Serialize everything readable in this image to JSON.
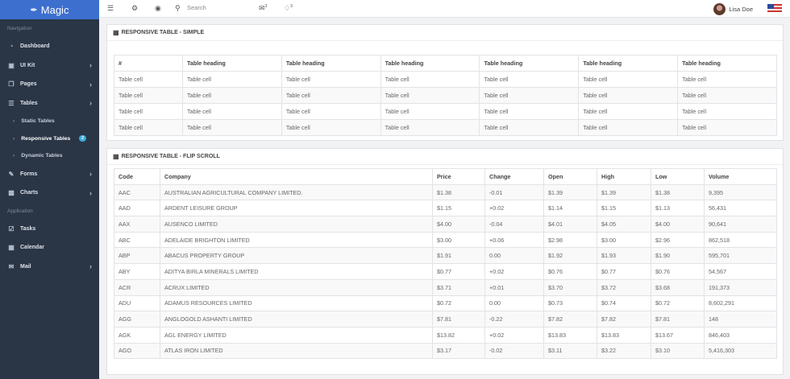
{
  "brand": {
    "name": "Magic",
    "icon": "feather-icon"
  },
  "sidebar": {
    "navigation_label": "Navigation",
    "application_label": "Application",
    "nav_items": [
      {
        "label": "Dashboard",
        "icon": "dashboard-icon"
      },
      {
        "label": "UI Kit",
        "icon": "box-icon"
      },
      {
        "label": "Pages",
        "icon": "pages-icon"
      },
      {
        "label": "Tables",
        "icon": "table-icon"
      }
    ],
    "sub_items": [
      {
        "label": "Static Tables"
      },
      {
        "label": "Responsive Tables",
        "badge": "2"
      },
      {
        "label": "Dynamic Tables"
      }
    ],
    "nav_items2": [
      {
        "label": "Forms",
        "icon": "pencil-icon"
      },
      {
        "label": "Charts",
        "icon": "chart-icon"
      }
    ],
    "app_items": [
      {
        "label": "Tasks",
        "icon": "tasks-icon"
      },
      {
        "label": "Calendar",
        "icon": "calendar-icon"
      },
      {
        "label": "Mail",
        "icon": "mail-icon"
      }
    ]
  },
  "topbar": {
    "search_placeholder": "Search",
    "mail_count": "3",
    "notif_count": "3",
    "user_name": "Lisa Doe"
  },
  "simple_table": {
    "title": "RESPONSIVE TABLE - SIMPLE",
    "headers": [
      "#",
      "Table heading",
      "Table heading",
      "Table heading",
      "Table heading",
      "Table heading",
      "Table heading"
    ],
    "rows": [
      [
        "Table cell",
        "Table cell",
        "Table cell",
        "Table cell",
        "Table cell",
        "Table cell",
        "Table cell"
      ],
      [
        "Table cell",
        "Table cell",
        "Table cell",
        "Table cell",
        "Table cell",
        "Table cell",
        "Table cell"
      ],
      [
        "Table cell",
        "Table cell",
        "Table cell",
        "Table cell",
        "Table cell",
        "Table cell",
        "Table cell"
      ],
      [
        "Table cell",
        "Table cell",
        "Table cell",
        "Table cell",
        "Table cell",
        "Table cell",
        "Table cell"
      ]
    ]
  },
  "flip_table": {
    "title": "RESPONSIVE TABLE - FLIP SCROLL",
    "headers": [
      "Code",
      "Company",
      "Price",
      "Change",
      "Open",
      "High",
      "Low",
      "Volume"
    ],
    "rows": [
      [
        "AAC",
        "AUSTRALIAN AGRICULTURAL COMPANY LIMITED.",
        "$1.38",
        "-0.01",
        "$1.39",
        "$1.39",
        "$1.38",
        "9,395"
      ],
      [
        "AAD",
        "ARDENT LEISURE GROUP",
        "$1.15",
        "+0.02",
        "$1.14",
        "$1.15",
        "$1.13",
        "56,431"
      ],
      [
        "AAX",
        "AUSENCO LIMITED",
        "$4.00",
        "-0.04",
        "$4.01",
        "$4.05",
        "$4.00",
        "90,641"
      ],
      [
        "ABC",
        "ADELAIDE BRIGHTON LIMITED",
        "$3.00",
        "+0.06",
        "$2.98",
        "$3.00",
        "$2.96",
        "862,518"
      ],
      [
        "ABP",
        "ABACUS PROPERTY GROUP",
        "$1.91",
        "0.00",
        "$1.92",
        "$1.93",
        "$1.90",
        "595,701"
      ],
      [
        "ABY",
        "ADITYA BIRLA MINERALS LIMITED",
        "$0.77",
        "+0.02",
        "$0.76",
        "$0.77",
        "$0.76",
        "54,567"
      ],
      [
        "ACR",
        "ACRUX LIMITED",
        "$3.71",
        "+0.01",
        "$3.70",
        "$3.72",
        "$3.68",
        "191,373"
      ],
      [
        "ADU",
        "ADAMUS RESOURCES LIMITED",
        "$0.72",
        "0.00",
        "$0.73",
        "$0.74",
        "$0.72",
        "8,602,291"
      ],
      [
        "AGG",
        "ANGLOGOLD ASHANTI LIMITED",
        "$7.81",
        "-0.22",
        "$7.82",
        "$7.82",
        "$7.81",
        "148"
      ],
      [
        "AGK",
        "AGL ENERGY LIMITED",
        "$13.82",
        "+0.02",
        "$13.83",
        "$13.83",
        "$13.67",
        "846,403"
      ],
      [
        "AGO",
        "ATLAS IRON LIMITED",
        "$3.17",
        "-0.02",
        "$3.11",
        "$3.22",
        "$3.10",
        "5,416,303"
      ]
    ]
  }
}
